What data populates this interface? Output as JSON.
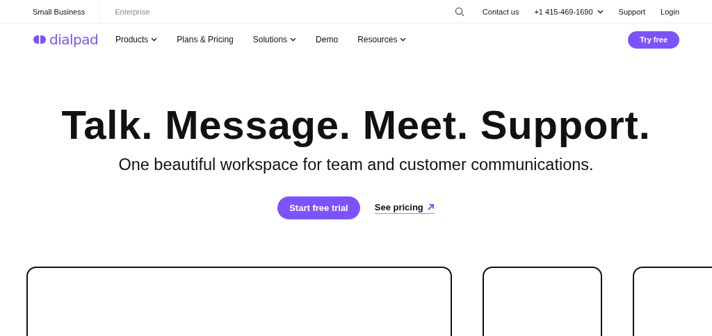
{
  "segments": [
    {
      "label": "Small Business",
      "selected": true
    },
    {
      "label": "Enterprise",
      "selected": false
    }
  ],
  "utility_links": [
    {
      "label": "Contact us",
      "has_menu": false
    },
    {
      "label": "+1 415-469-1690",
      "has_menu": true
    },
    {
      "label": "Support",
      "has_menu": false
    },
    {
      "label": "Login",
      "has_menu": false
    }
  ],
  "logo": {
    "text": "dialpad"
  },
  "nav": [
    {
      "label": "Products",
      "has_menu": true
    },
    {
      "label": "Plans & Pricing",
      "has_menu": false
    },
    {
      "label": "Solutions",
      "has_menu": true
    },
    {
      "label": "Demo",
      "has_menu": false
    },
    {
      "label": "Resources",
      "has_menu": true
    }
  ],
  "nav_button": "Try free",
  "hero": {
    "headline": "Talk. Message. Meet. Support.",
    "subtitle": "One beautiful workspace for team and customer communications.",
    "primary_button": "Start free trial",
    "secondary_link": "See pricing"
  },
  "cards": [
    {
      "kind": "wide"
    },
    {
      "kind": "narrow"
    },
    {
      "kind": "narrow"
    }
  ]
}
